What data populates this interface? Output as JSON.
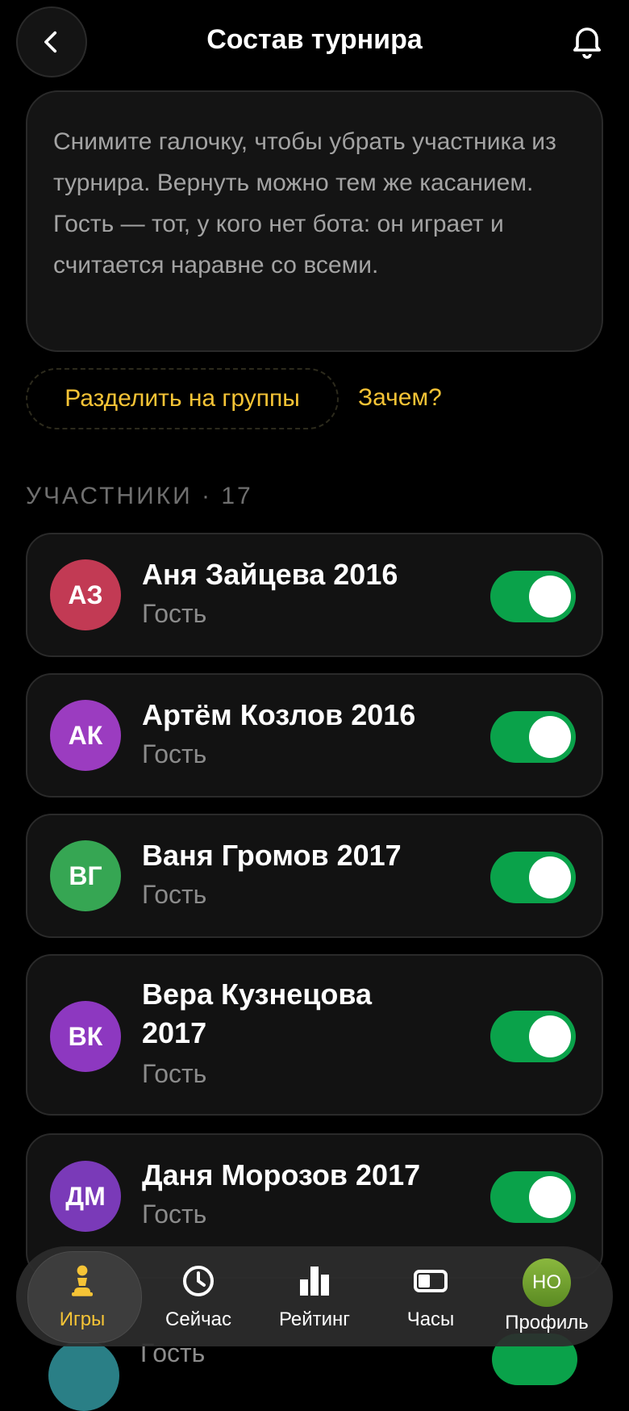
{
  "header": {
    "title": "Состав турнира",
    "back_icon": "chevron-left-icon",
    "bell_icon": "bell-icon"
  },
  "info": {
    "text": "Снимите галочку, чтобы убрать участника из турнира. Вернуть можно тем же касанием. Гость — тот, у кого нет бота: он играет и считается наравне со всеми."
  },
  "actions": {
    "split_label": "Разделить на группы",
    "why_label": "Зачем?"
  },
  "section": {
    "label": "УЧАСТНИКИ · 17"
  },
  "participants": [
    {
      "initials": "АЗ",
      "name": "Аня Зайцева 2016",
      "role": "Гость",
      "enabled": true,
      "color": "#c23a54"
    },
    {
      "initials": "АК",
      "name": "Артём Козлов 2016",
      "role": "Гость",
      "enabled": true,
      "color": "#9b3cc0"
    },
    {
      "initials": "ВГ",
      "name": "Ваня Громов 2017",
      "role": "Гость",
      "enabled": true,
      "color": "#36a653"
    },
    {
      "initials": "ВК",
      "name": "Вера Кузнецова 2017",
      "role": "Гость",
      "enabled": true,
      "color": "#8d38c0"
    },
    {
      "initials": "ДМ",
      "name": "Даня Морозов 2017",
      "role": "Гость",
      "enabled": true,
      "color": "#7a3ab8"
    },
    {
      "initials": "",
      "name": "",
      "role": "Гость",
      "enabled": true,
      "color": "#2a7f86"
    }
  ],
  "nav": {
    "games": "Игры",
    "now": "Сейчас",
    "rating": "Рейтинг",
    "clock": "Часы",
    "profile": "Профиль",
    "profile_initials": "НО",
    "active": "games"
  },
  "colors": {
    "accent": "#f6c436",
    "toggle_on": "#0aa24a",
    "background": "#000000"
  }
}
